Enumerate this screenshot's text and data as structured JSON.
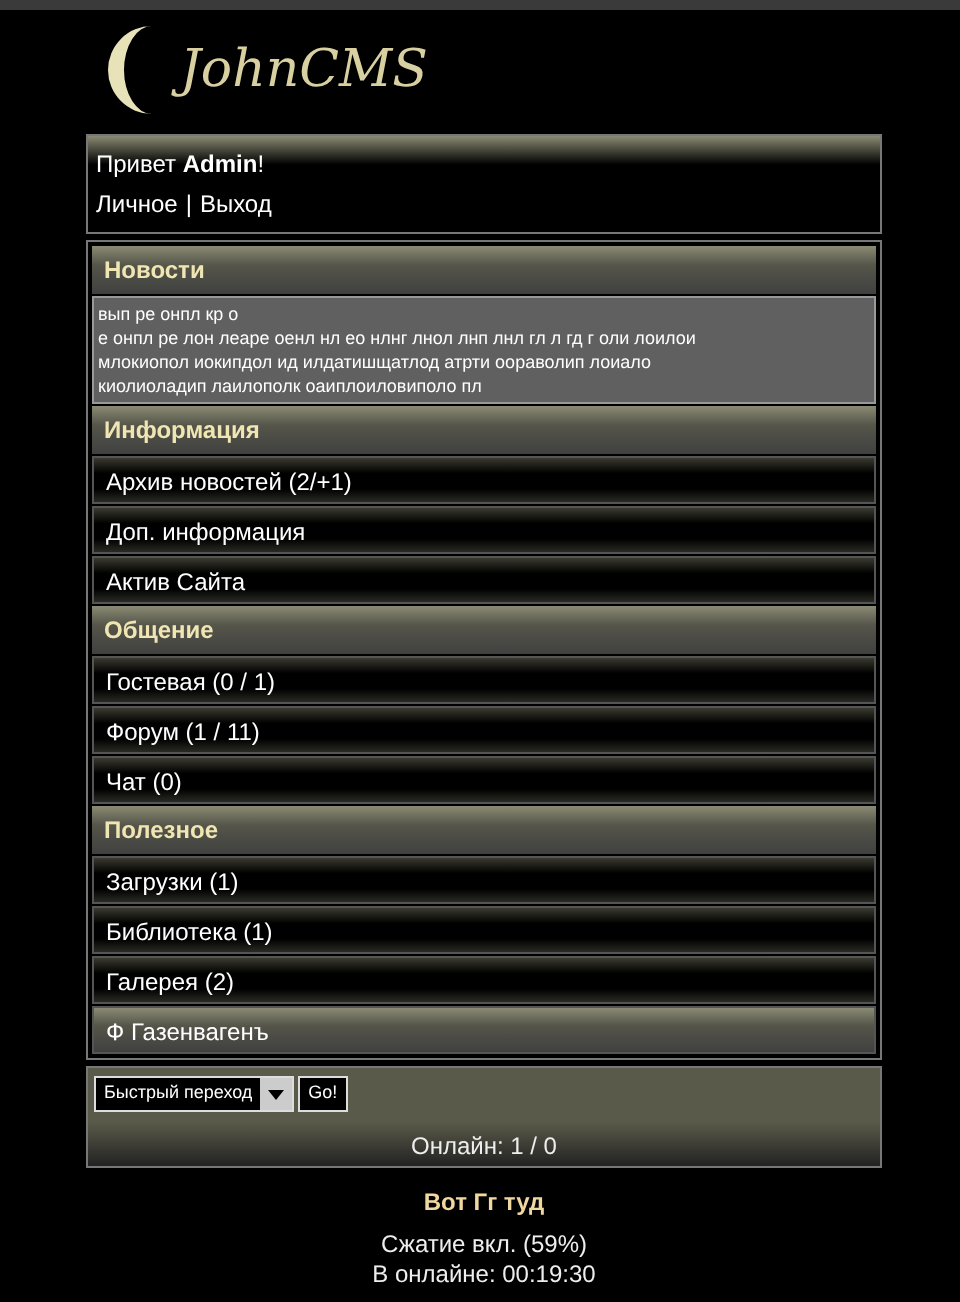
{
  "logo": {
    "text": "JohnCMS"
  },
  "user": {
    "greeting": "Привет **Admin**!",
    "links": [
      "Личное",
      "Выход"
    ],
    "separator": "|"
  },
  "news": {
    "title": "Новости",
    "lines": [
      "вып ре онпл кр о",
      "е онпл ре лон леаре оенл нл ео нлнг лнол лнп лнл гл л гд г оли лоилои",
      "млокиопол иокипдол ид илдатишщатлод атрти оораволип лоиало",
      "киолиоладип лаилополк оаиплоиловиполо пл"
    ]
  },
  "sections": [
    {
      "title": "Информация",
      "items": [
        {
          "label": "Архив новостей (2/+1)",
          "kind": "link"
        },
        {
          "label": "Доп. информация",
          "kind": "link"
        },
        {
          "label": "Актив Сайта",
          "kind": "link"
        }
      ]
    },
    {
      "title": "Общение",
      "items": [
        {
          "label": "Гостевая (0 / 1)",
          "kind": "link"
        },
        {
          "label": "Форум (1 / 11)",
          "kind": "link"
        },
        {
          "label": "Чат (0)",
          "kind": "link"
        }
      ]
    },
    {
      "title": "Полезное",
      "items": [
        {
          "label": "Загрузки (1)",
          "kind": "link"
        },
        {
          "label": "Библиотека (1)",
          "kind": "link"
        },
        {
          "label": "Галерея (2)",
          "kind": "link"
        },
        {
          "label": "Ф Газенвагенъ",
          "kind": "accent"
        }
      ]
    }
  ],
  "quick_jump": {
    "value": "Быстрый переход",
    "button": "Go!"
  },
  "online": "Онлайн: 1 / 0",
  "footer": {
    "title": "Вот Гг туд",
    "lines": [
      "Сжатие вкл. (59%)",
      "В онлайне: 00:19:30"
    ]
  }
}
